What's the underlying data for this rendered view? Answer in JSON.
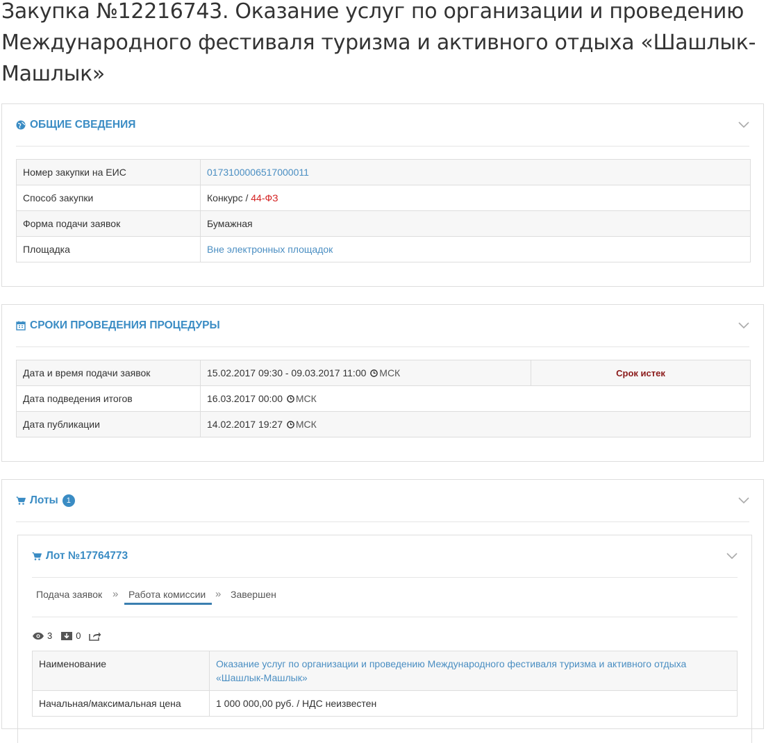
{
  "page_title": "Закупка №12216743. Оказание услуг по организации и проведению Международного фестиваля туризма и активного отдыха «Шашлык-Машлык»",
  "general": {
    "title": "ОБЩИЕ СВЕДЕНИЯ",
    "rows": [
      {
        "label": "Номер закупки на ЕИС",
        "value": "0173100006517000011"
      },
      {
        "label": "Способ закупки",
        "value": "Конкурс / ",
        "value_extra": "44-ФЗ"
      },
      {
        "label": "Форма подачи заявок",
        "value": "Бумажная"
      },
      {
        "label": "Площадка",
        "value": "Вне электронных площадок"
      }
    ]
  },
  "schedule": {
    "title": "СРОКИ ПРОВЕДЕНИЯ ПРОЦЕДУРЫ",
    "rows": [
      {
        "label": "Дата и время подачи заявок",
        "value": "15.02.2017 09:30 - 09.03.2017 11:00",
        "tz": "МСК",
        "status": "Срок истек"
      },
      {
        "label": "Дата подведения итогов",
        "value": "16.03.2017 00:00",
        "tz": "МСК"
      },
      {
        "label": "Дата публикации",
        "value": "14.02.2017 19:27",
        "tz": "МСК"
      }
    ]
  },
  "lots": {
    "title": "Лоты",
    "count": "1",
    "lot": {
      "title": "Лот №17764773",
      "steps": [
        "Подача заявок",
        "Работа комиссии",
        "Завершен"
      ],
      "active_step": "Работа комиссии",
      "stats": {
        "views": "3",
        "downloads": "0"
      },
      "rows": [
        {
          "label": "Наименование",
          "value": "Оказание услуг по организации и проведению Международного фестиваля туризма и активного отдыха «Шашлык-Машлык»"
        },
        {
          "label": "Начальная/максимальная цена",
          "value": "1 000 000,00 руб. / НДС неизвестен"
        }
      ]
    }
  },
  "colors": {
    "accent": "#3a8cc4",
    "link": "#4a8ec2",
    "law": "#d42222",
    "expired": "#8b1a1a"
  }
}
